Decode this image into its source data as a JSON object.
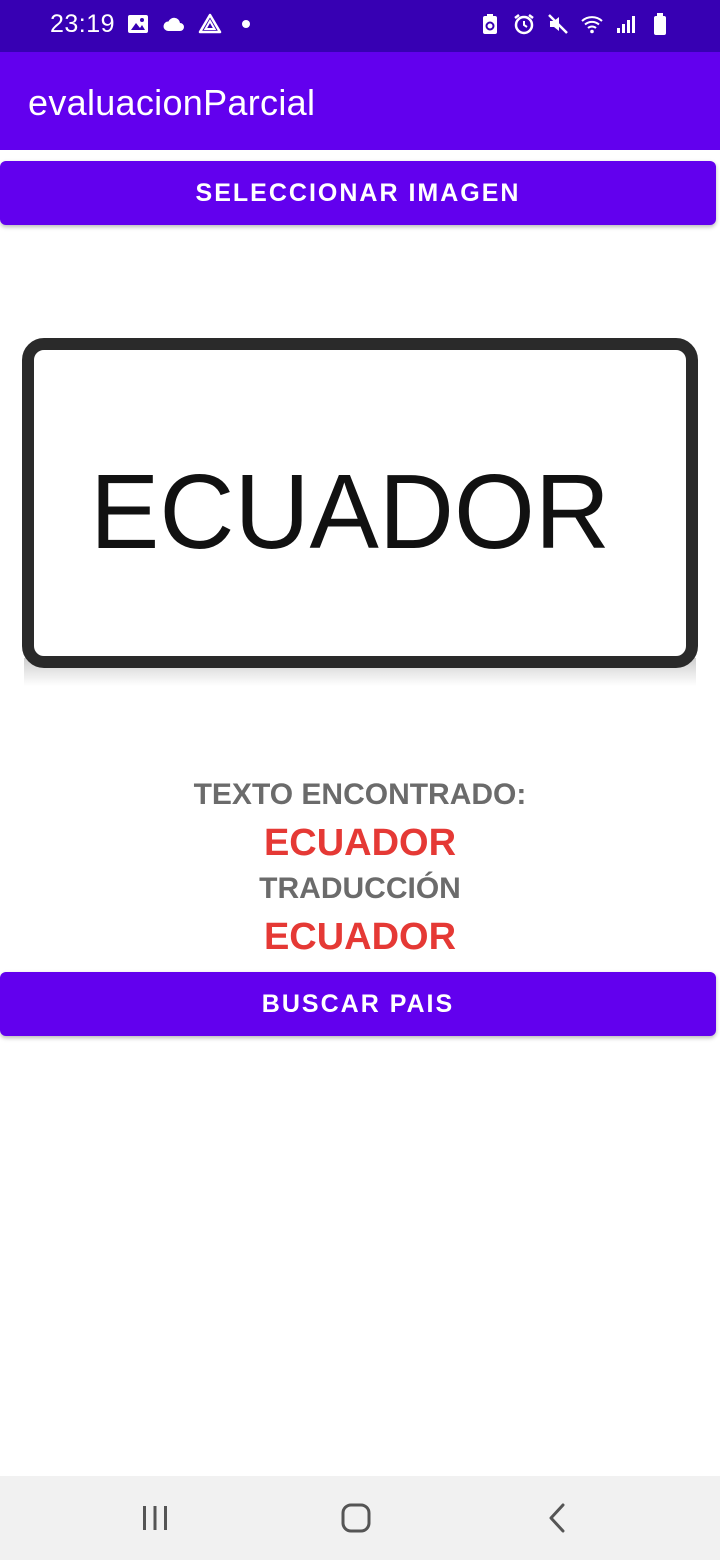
{
  "status_bar": {
    "time": "23:19",
    "left_icons": [
      "image-icon",
      "cloud-icon",
      "drive-icon",
      "dot-icon"
    ],
    "right_icons": [
      "battery-saver-icon",
      "alarm-icon",
      "mute-icon",
      "wifi-icon",
      "signal-icon",
      "battery-icon"
    ]
  },
  "app_bar": {
    "title": "evaluacionParcial"
  },
  "buttons": {
    "select_image": "SELECCIONAR IMAGEN",
    "search_country": "BUSCAR PAIS"
  },
  "image": {
    "sign_text": "ECUADOR"
  },
  "results": {
    "found_label": "TEXTO ENCONTRADO:",
    "found_value": "ECUADOR",
    "translation_label": "TRADUCCIÓN",
    "translation_value": "ECUADOR"
  },
  "nav_bar": {
    "buttons": [
      "recent-apps-icon",
      "home-icon",
      "back-icon"
    ]
  },
  "colors": {
    "status_bar": "#3700b3",
    "primary": "#6200ee",
    "result_value": "#e53935",
    "result_label": "#6b6b6b",
    "nav_bar": "#f1f1f1"
  }
}
